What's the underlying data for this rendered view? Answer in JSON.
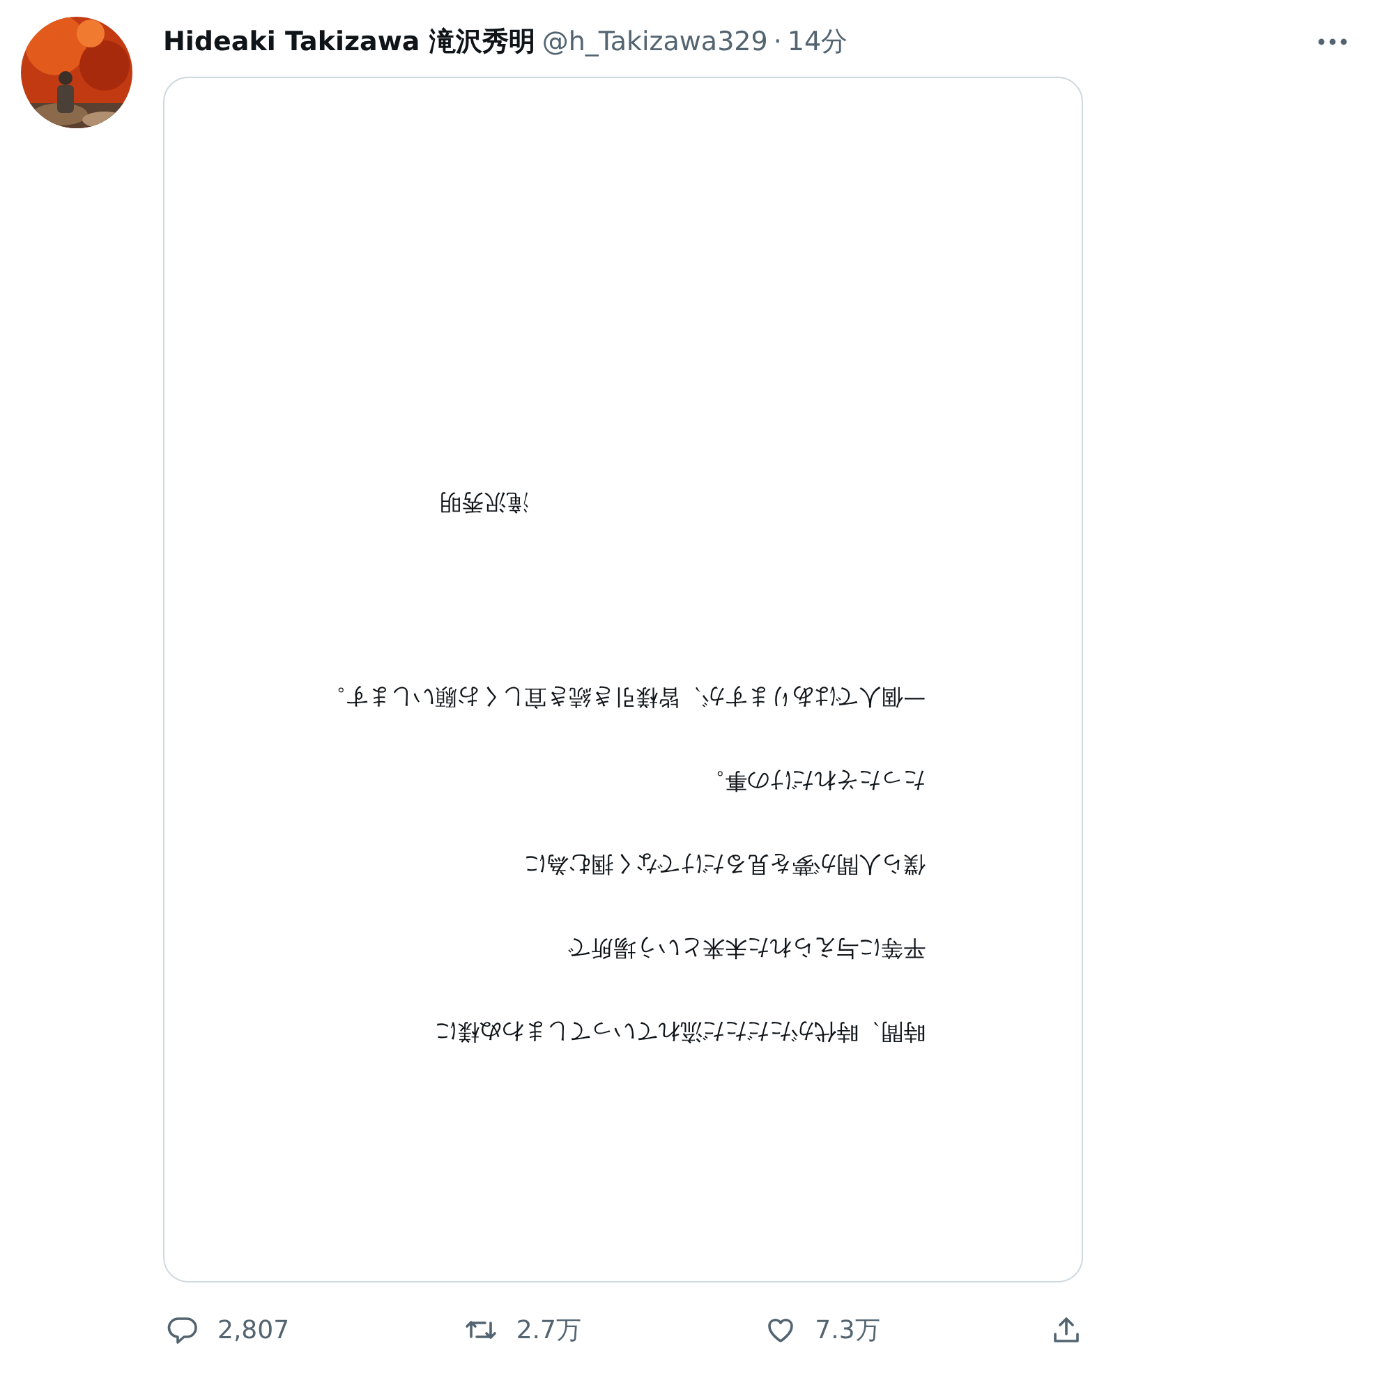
{
  "post": {
    "author_name": "Hideaki Takizawa 滝沢秀明",
    "handle": "@h_Takizawa329",
    "separator": "·",
    "time": "14分"
  },
  "attachment": {
    "kind": "document",
    "lines": [
      "時間、時代がただただ流れていってしまわぬ様に",
      "平等に与えられた未来という場所で",
      "僕ら人間が夢を見るだけでなく掴む為に",
      "たったそれだけの事。",
      "一個人ではありますが、皆様引き続き宜しくお願いします。"
    ],
    "signature": "滝沢秀明"
  },
  "actions": [
    {
      "kind": "reply",
      "count": "2,807"
    },
    {
      "kind": "repost",
      "count": "2.7万"
    },
    {
      "kind": "like",
      "count": "7.3万"
    },
    {
      "kind": "share"
    }
  ]
}
